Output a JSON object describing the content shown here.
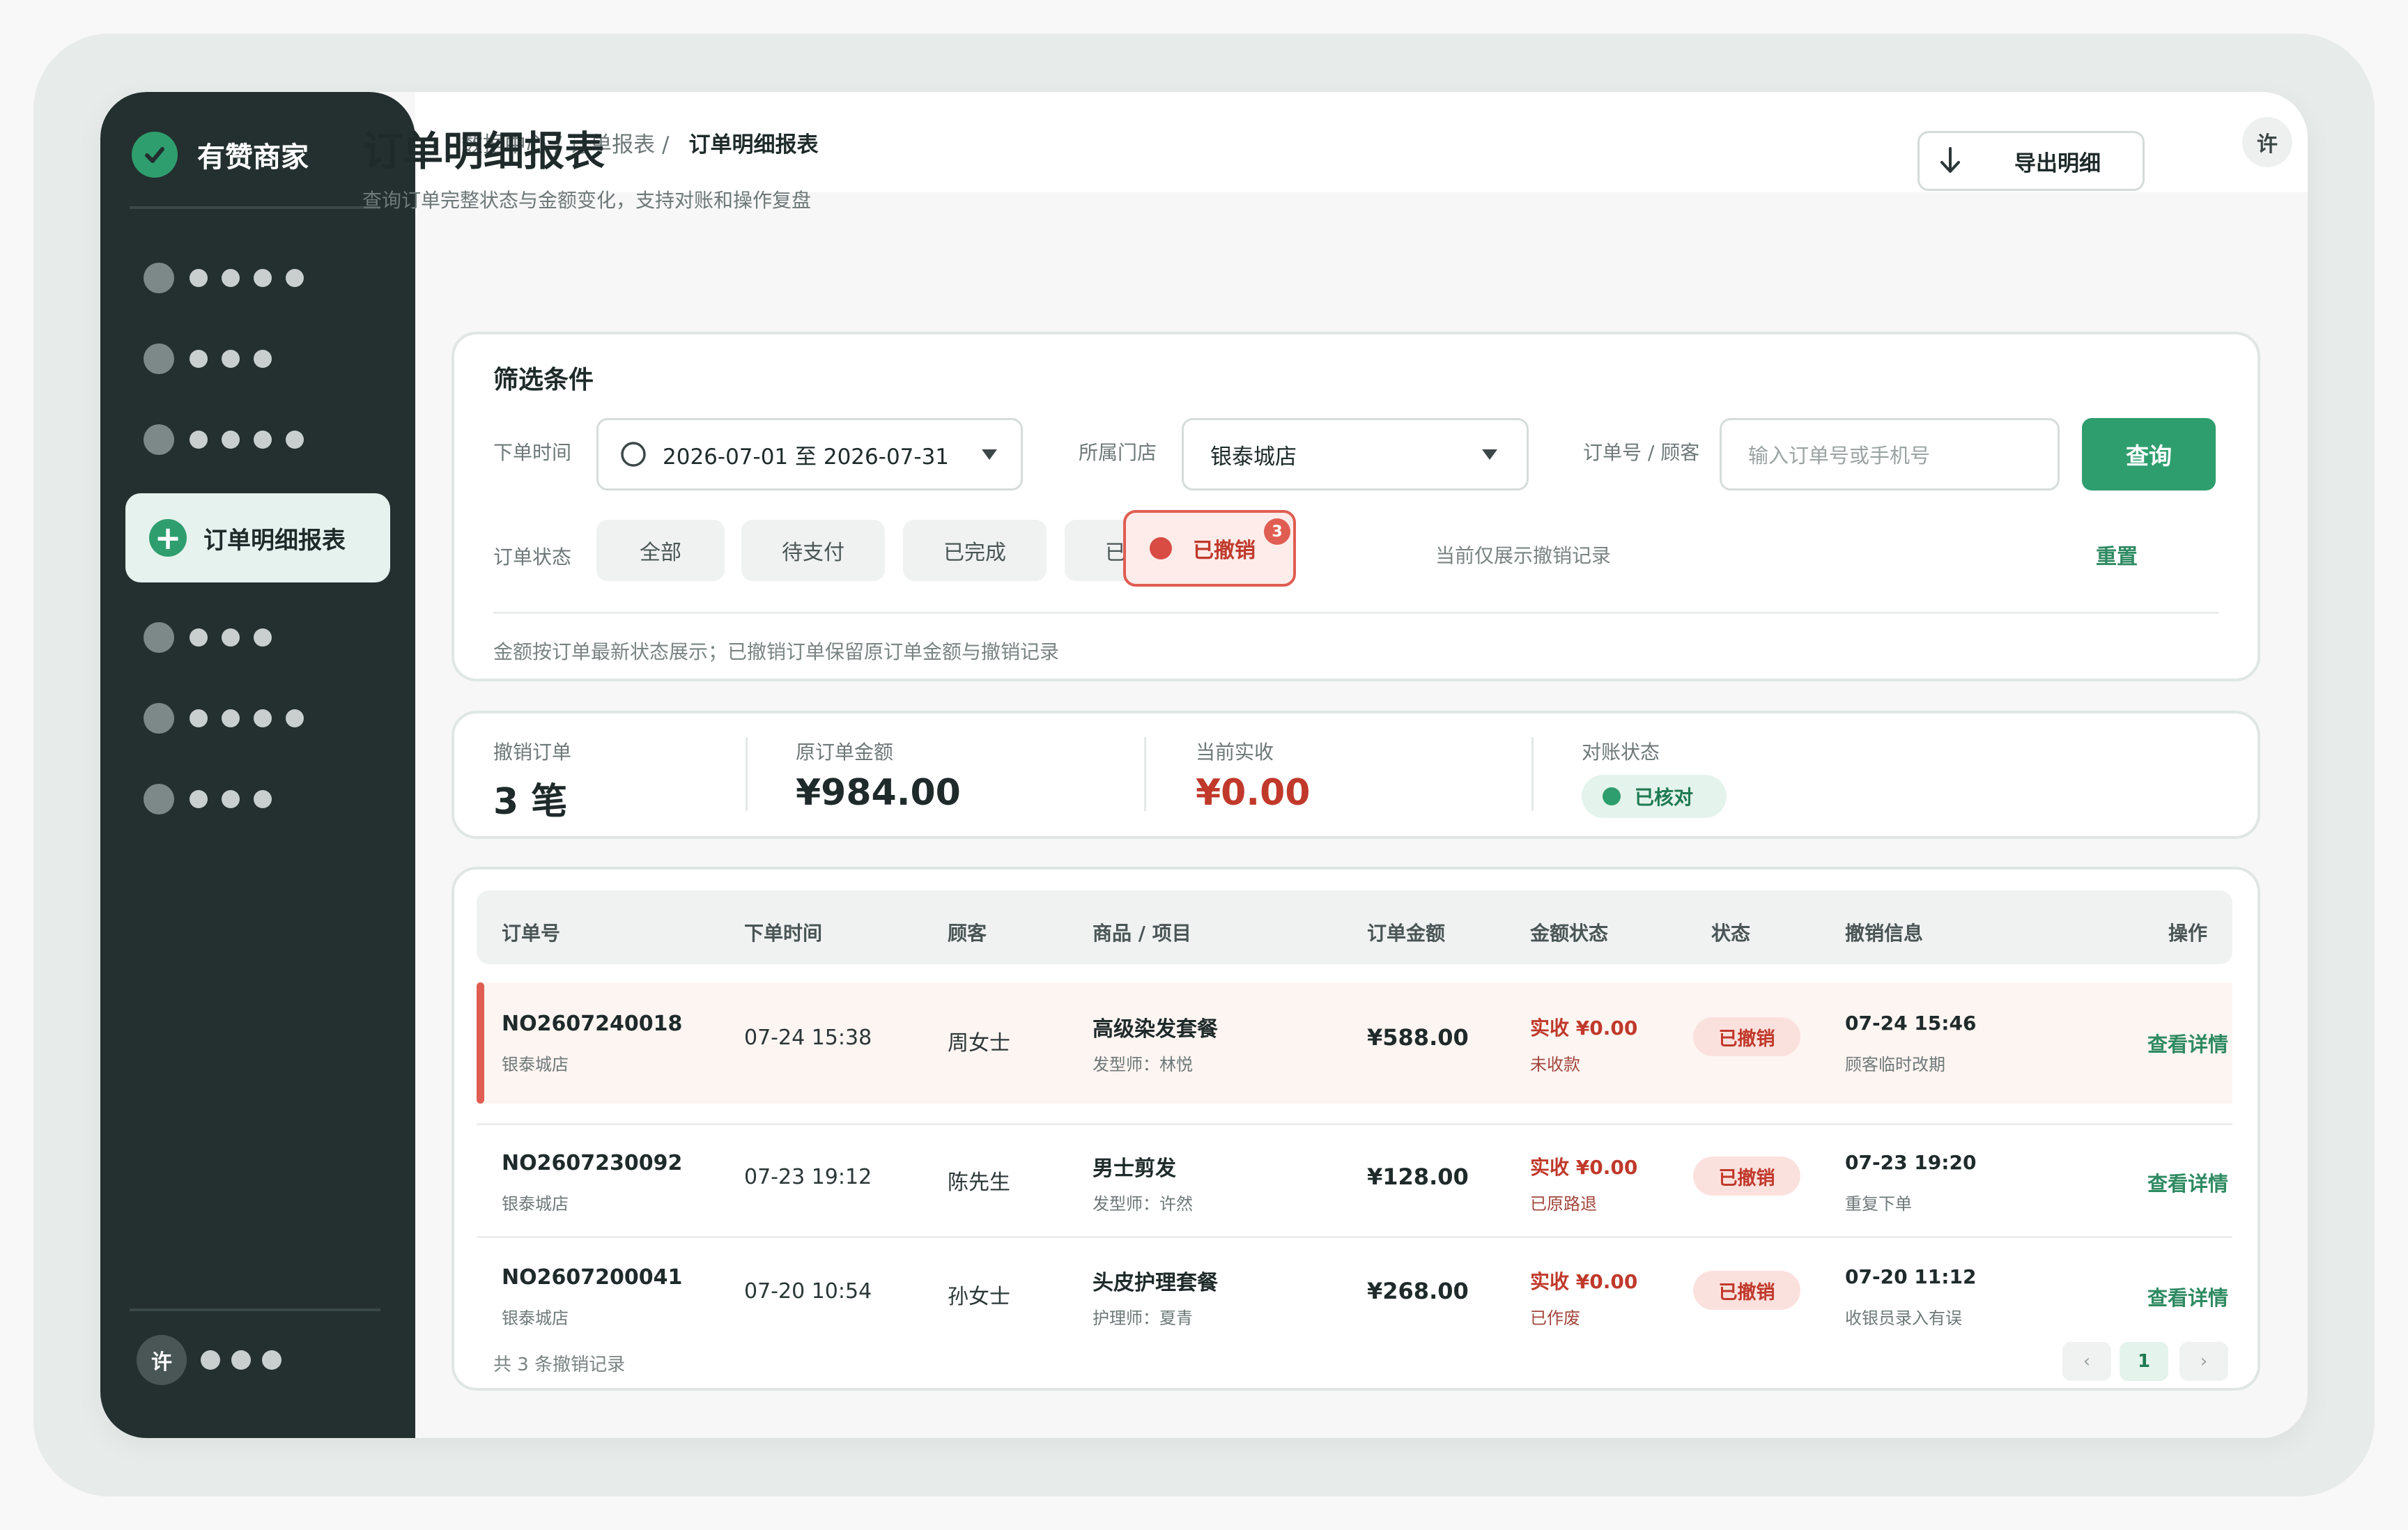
{
  "brand": {
    "name": "有赞商家"
  },
  "sidebar": {
    "active_item": "订单明细报表",
    "user_initial": "许"
  },
  "breadcrumb": {
    "path": "数据中心 / 订单报表 /",
    "current": "订单明细报表"
  },
  "header": {
    "user_initial": "许"
  },
  "page": {
    "title": "订单明细报表",
    "subtitle": "查询订单完整状态与金额变化，支持对账和操作复盘",
    "export_label": "导出明细"
  },
  "filters": {
    "title": "筛选条件",
    "time_label": "下单时间",
    "time_value": "2026-07-01 至 2026-07-31",
    "store_label": "所属门店",
    "store_value": "银泰城店",
    "search_label": "订单号 / 顾客",
    "search_placeholder": "输入订单号或手机号",
    "query_label": "查询",
    "status_label": "订单状态",
    "status_options": [
      "全部",
      "待支付",
      "已完成",
      "已退款"
    ],
    "active_status": "已撤销",
    "active_badge": "3",
    "active_hint": "当前仅展示撤销记录",
    "reset_label": "重置",
    "footnote": "金额按订单最新状态展示；已撤销订单保留原订单金额与撤销记录"
  },
  "stats": {
    "canceled_label": "撤销订单",
    "canceled_value": "3 笔",
    "original_label": "原订单金额",
    "original_value": "¥984.00",
    "received_label": "当前实收",
    "received_value": "¥0.00",
    "recon_label": "对账状态",
    "recon_value": "已核对"
  },
  "table": {
    "headers": [
      "订单号",
      "下单时间",
      "顾客",
      "商品 / 项目",
      "订单金额",
      "金额状态",
      "状态",
      "撤销信息",
      "操作"
    ],
    "rows": [
      {
        "order_no": "NO2607240018",
        "store": "银泰城店",
        "time": "07-24 15:38",
        "customer": "周女士",
        "product": "高级染发套餐",
        "staff": "发型师：林悦",
        "amount": "¥588.00",
        "received": "实收 ¥0.00",
        "received_note": "未收款",
        "status": "已撤销",
        "cancel_time": "07-24 15:46",
        "cancel_reason": "顾客临时改期",
        "action": "查看详情"
      },
      {
        "order_no": "NO2607230092",
        "store": "银泰城店",
        "time": "07-23 19:12",
        "customer": "陈先生",
        "product": "男士剪发",
        "staff": "发型师：许然",
        "amount": "¥128.00",
        "received": "实收 ¥0.00",
        "received_note": "已原路退",
        "status": "已撤销",
        "cancel_time": "07-23 19:20",
        "cancel_reason": "重复下单",
        "action": "查看详情"
      },
      {
        "order_no": "NO2607200041",
        "store": "银泰城店",
        "time": "07-20 10:54",
        "customer": "孙女士",
        "product": "头皮护理套餐",
        "staff": "护理师：夏青",
        "amount": "¥268.00",
        "received": "实收 ¥0.00",
        "received_note": "已作废",
        "status": "已撤销",
        "cancel_time": "07-20 11:12",
        "cancel_reason": "收银员录入有误",
        "action": "查看详情"
      }
    ],
    "footer": "共 3 条撤销记录",
    "pagination": {
      "prev": "‹",
      "current": "1",
      "next": "›"
    }
  },
  "colors": {
    "accent": "#2f9e6e",
    "danger": "#c0392b",
    "sidebar": "#23302f"
  }
}
